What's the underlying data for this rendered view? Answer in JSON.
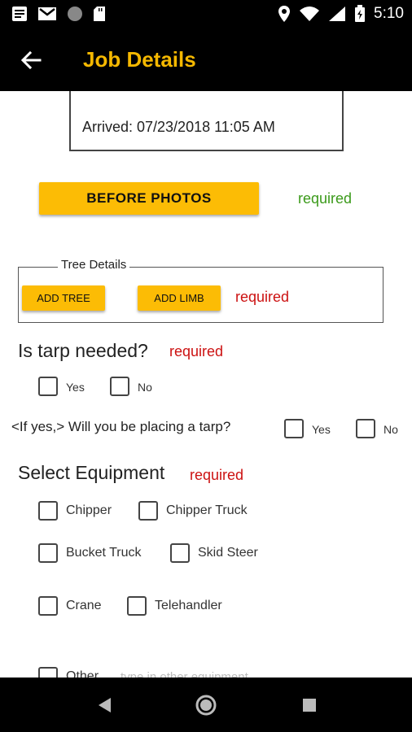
{
  "status_bar": {
    "time": "5:10",
    "left_icons": [
      "notes-icon",
      "gmail-icon",
      "circle-icon",
      "sd-card-icon"
    ],
    "right_icons": [
      "location-icon",
      "wifi-icon",
      "signal-icon",
      "battery-icon"
    ]
  },
  "app_bar": {
    "title": "Job Details",
    "back_icon": "arrow-back-icon",
    "title_color": "#f5b800"
  },
  "job": {
    "arrived_label": "Arrived: 07/23/2018 11:05 AM"
  },
  "photos": {
    "button_label": "BEFORE PHOTOS",
    "required_label": "required"
  },
  "tree_details": {
    "legend": "Tree Details",
    "add_tree_label": "ADD TREE",
    "add_limb_label": "ADD LIMB",
    "required_label": "required"
  },
  "tarp": {
    "question": "Is tarp needed?",
    "required_label": "required",
    "yes_label": "Yes",
    "no_label": "No",
    "placing_question": "<If yes,> Will you be placing a tarp?",
    "placing_yes_label": "Yes",
    "placing_no_label": "No"
  },
  "equipment": {
    "title": "Select Equipment",
    "required_label": "required",
    "options": [
      "Chipper",
      "Chipper Truck",
      "Bucket Truck",
      "Skid Steer",
      "Crane",
      "Telehandler",
      "Other"
    ],
    "other_placeholder": "type in other equipment"
  },
  "colors": {
    "accent_yellow": "#fcbc05",
    "required_green": "#3b9a1a",
    "required_red": "#cc1111"
  },
  "nav_bar": {
    "icons": [
      "back-triangle-icon",
      "home-circle-icon",
      "recents-square-icon"
    ]
  }
}
